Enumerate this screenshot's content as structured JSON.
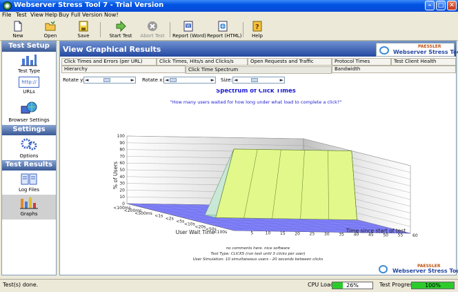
{
  "window": {
    "title": "Webserver Stress Tool 7 - Trial Version"
  },
  "menu": [
    "File",
    "Test",
    "View",
    "Help",
    "Buy Full Version Now!"
  ],
  "toolbar": {
    "new": "New",
    "open": "Open",
    "save": "Save",
    "start": "Start Test",
    "abort": "Abort Test",
    "report_word": "Report (Word)",
    "report_html": "Report (HTML)",
    "help": "Help"
  },
  "sidebar": {
    "setup_heading": "Test Setup",
    "test_type": "Test Type",
    "urls": "URLs",
    "urls_icon_text": "http://",
    "browser": "Browser Settings",
    "settings_heading": "Settings",
    "options": "Options",
    "results_heading": "Test Results",
    "log_files": "Log Files",
    "graphs": "Graphs"
  },
  "main": {
    "title": "View Graphical Results",
    "logo_brand": "PAESSLER",
    "logo_name": "Webserver Stress Tool",
    "tabs_row1": [
      "Click Times and Errors (per URL)",
      "Click Times, Hits/s and Clicks/s",
      "Open Requests and Traffic",
      "Protocol Times",
      "Test Client Health"
    ],
    "tabs_row2": [
      "Hierarchy",
      "Click Time Spectrum",
      "Bandwidth"
    ],
    "rotate_y_label": "Rotate y:",
    "rotate_x_label": "Rotate x:",
    "size_label": "Size:",
    "notes": [
      "no comments here. nice software",
      "Test Type: CLICKS (run test until 3 clicks per user)",
      "User Simulation: 10 simultaneous users - 20 seconds between clicks"
    ]
  },
  "chart_data": {
    "type": "area",
    "title": "Spectrum of Click Times",
    "subtitle": "\"How many users waited for how long under what load to complete a click?\"",
    "ylabel": "% of Users",
    "xlabel": "User Wait Time",
    "zlabel": "Time since start of test",
    "ylim": [
      0,
      100
    ],
    "y_ticks": [
      0,
      10,
      20,
      30,
      40,
      50,
      60,
      70,
      80,
      90,
      100
    ],
    "x_categories": [
      "<100ms",
      "<200ms",
      "<500ms",
      "<1s",
      "<2s",
      "<5s",
      "<10s",
      "<20s",
      "<50s",
      "<100s"
    ],
    "z_ticks": [
      5,
      10,
      15,
      20,
      25,
      30,
      35,
      40,
      45,
      50,
      55,
      60
    ],
    "series": [
      {
        "bucket": "<2s",
        "start_time": 12,
        "peak_time": 20,
        "end_time": 60,
        "value": 100
      }
    ],
    "grid": true,
    "colors": {
      "floor": "#8080f8",
      "surface": "#e2f88a",
      "face": "#a8f0d0"
    }
  },
  "status": {
    "text": "Test(s) done.",
    "cpu_label": "CPU Load:",
    "cpu_value": 26,
    "cpu_text": "26%",
    "progress_label": "Test Progress:",
    "progress_value": 100,
    "progress_text": "100%"
  }
}
